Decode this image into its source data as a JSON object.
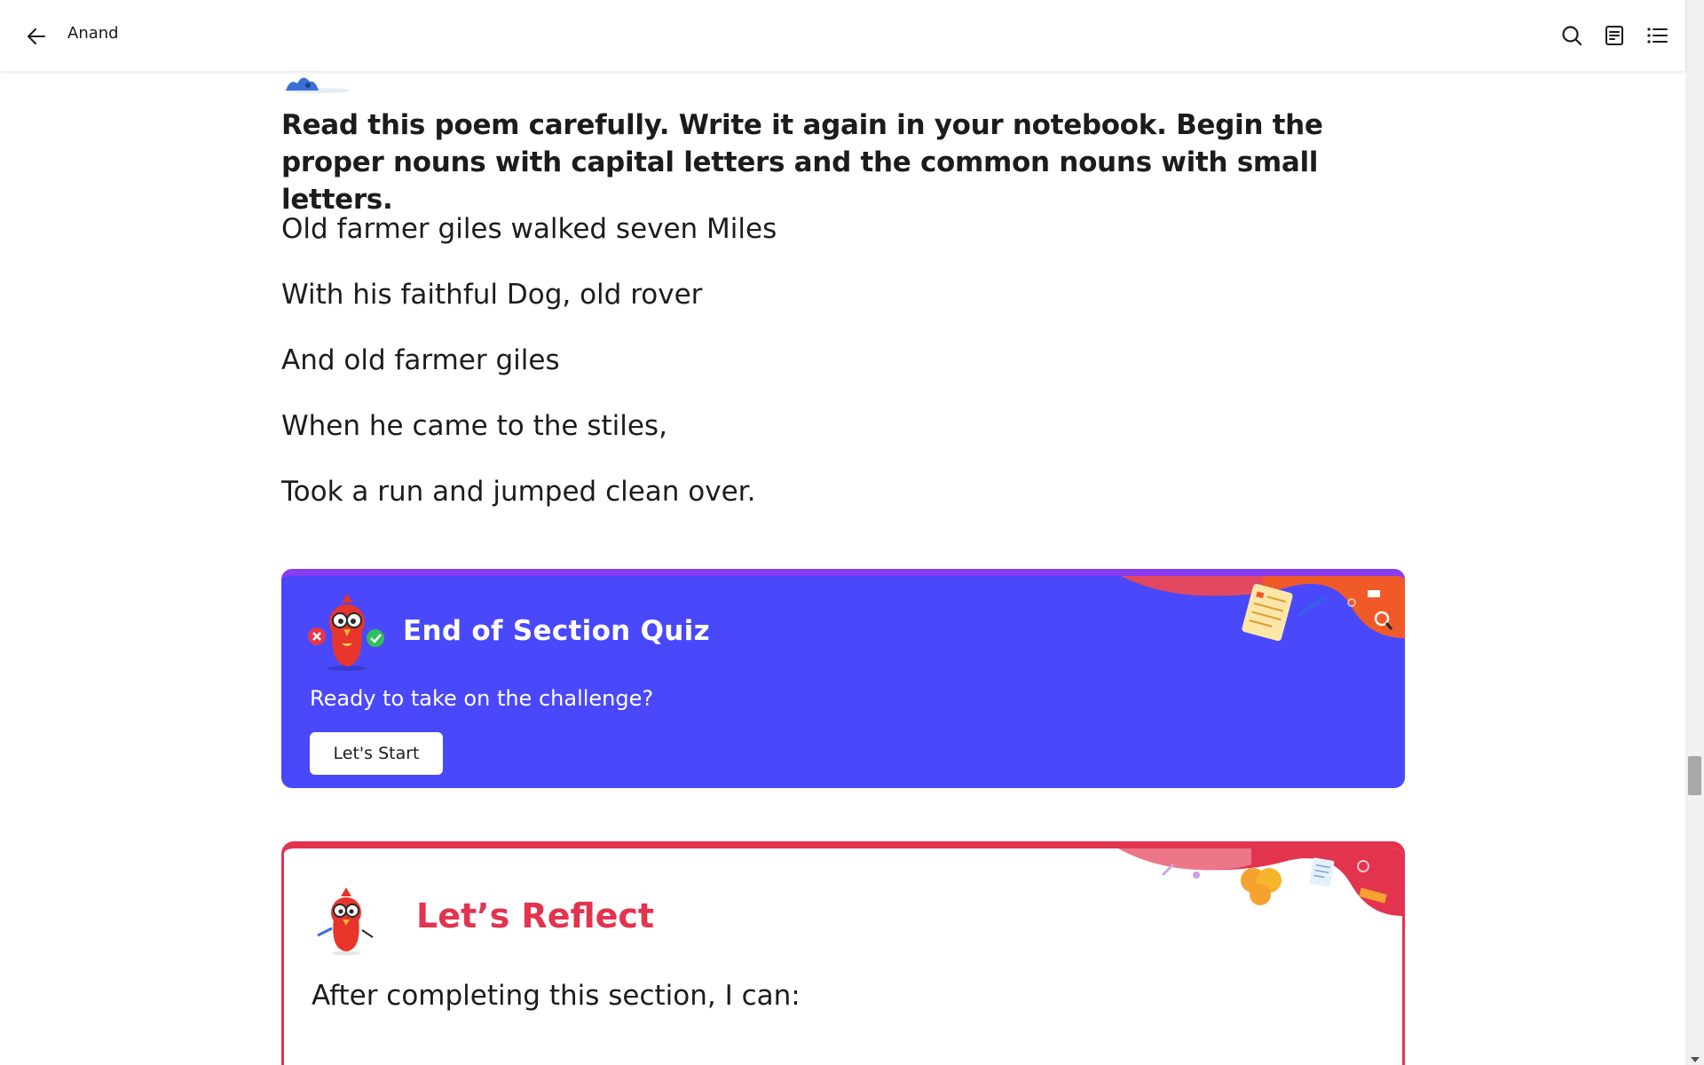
{
  "header": {
    "back_icon": "arrow-left-icon",
    "title": "Anand",
    "icons": [
      "search-icon",
      "notes-icon",
      "list-icon"
    ]
  },
  "instruction": "Read this poem carefully. Write it again in your notebook. Begin the proper nouns with capital letters and the common nouns with small letters.",
  "poem": [
    "Old farmer giles walked seven Miles",
    "With his faithful Dog, old rover",
    "And old farmer giles",
    "When he came to the stiles,",
    "Took a run and jumped clean over."
  ],
  "quiz": {
    "title": "End of Section Quiz",
    "subtitle": "Ready to take on the challenge?",
    "button_label": "Let's Start",
    "background_color": "#4a48fb",
    "accent_color": "#f05a28"
  },
  "reflect": {
    "title": "Let’s Reflect",
    "text": "After completing this section, I can:",
    "accent_color": "#e2344f"
  }
}
